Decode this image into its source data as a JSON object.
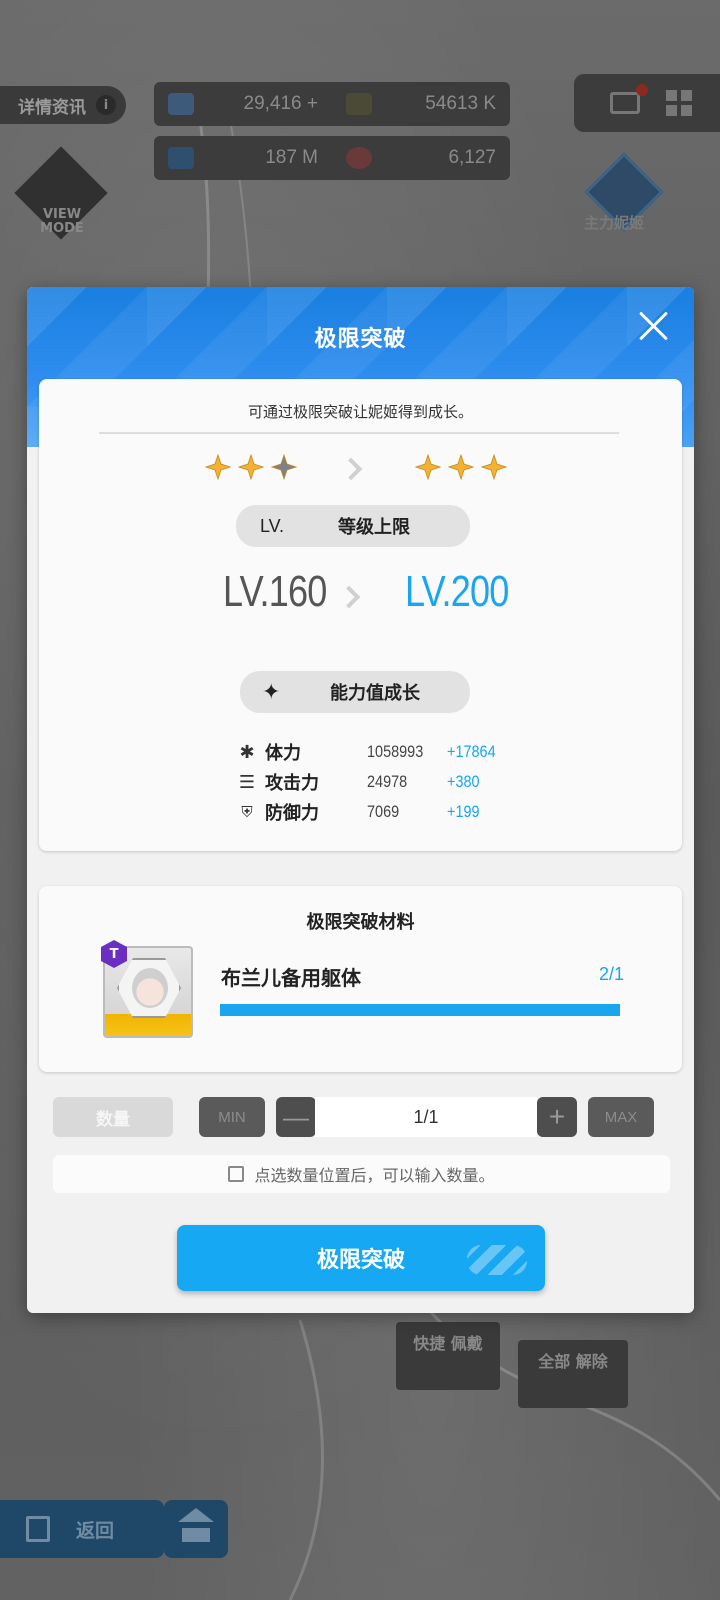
{
  "background": {
    "info_label": "详情资讯",
    "resources": [
      "29,416 +",
      "54613 K",
      "187 M",
      "6,127"
    ],
    "view_mode": "VIEW MODE",
    "main_nikke": "主力妮姬",
    "quick_equip": "快捷 佩戴",
    "unequip_all": "全部 解除",
    "back_label": "返回"
  },
  "modal": {
    "title": "极限突破",
    "subtitle": "可通过极限突破让妮姬得到成长。",
    "stars_before": {
      "filled": 2,
      "total": 3
    },
    "stars_after": {
      "filled": 3,
      "total": 3
    },
    "level_cap_prefix": "LV.",
    "level_cap_label": "等级上限",
    "level_from": "LV.160",
    "level_to": "LV.200",
    "growth_label": "能力值成长",
    "stats": [
      {
        "icon": "hp-icon",
        "name": "体力",
        "value": "1058993",
        "increase": "+17864"
      },
      {
        "icon": "attack-icon",
        "name": "攻击力",
        "value": "24978",
        "increase": "+380"
      },
      {
        "icon": "defense-icon",
        "name": "防御力",
        "value": "7069",
        "increase": "+199"
      }
    ],
    "materials_title": "极限突破材料",
    "material": {
      "tier": "T",
      "name": "布兰儿备用躯体",
      "count": "2/1",
      "progress": 1.0
    },
    "quantity_label": "数量",
    "min_label": "MIN",
    "max_label": "MAX",
    "quantity_value": "1/1",
    "hint": "点选数量位置后，可以输入数量。",
    "confirm_label": "极限突破"
  },
  "colors": {
    "accent": "#19a6ef",
    "header_blue": "#2f8ef0",
    "star_gold": "#f2b233",
    "star_gray": "#7d8288"
  }
}
